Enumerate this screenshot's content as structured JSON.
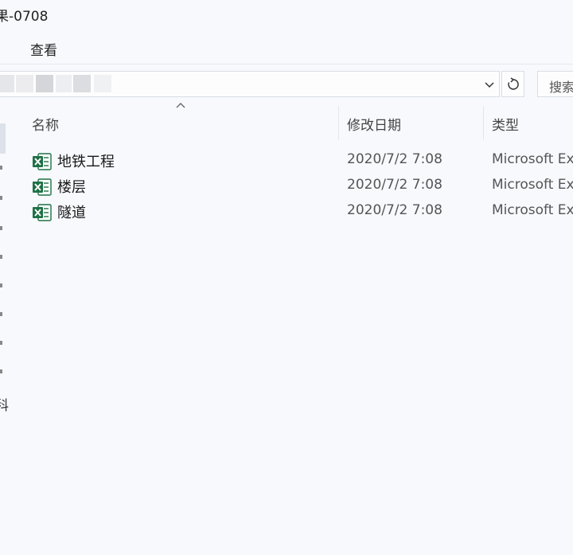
{
  "window": {
    "title": "果-0708"
  },
  "menu": {
    "view": "查看"
  },
  "search": {
    "placeholder": "搜索"
  },
  "icons": {
    "dropdown": "chevron-down-icon",
    "refresh": "refresh-icon",
    "sort": "sort-up-icon",
    "file": "excel-icon"
  },
  "columns": {
    "name": "名称",
    "date": "修改日期",
    "type": "类型"
  },
  "sidebar": {
    "partial_text": "科"
  },
  "files": [
    {
      "name": "地铁工程",
      "date": "2020/7/2 7:08",
      "type": "Microsoft Excel"
    },
    {
      "name": "楼层",
      "date": "2020/7/2 7:08",
      "type": "Microsoft Excel"
    },
    {
      "name": "隧道",
      "date": "2020/7/2 7:08",
      "type": "Microsoft Excel"
    }
  ],
  "colors": {
    "background": "#f7f9fd",
    "excel_green": "#1e7145"
  }
}
